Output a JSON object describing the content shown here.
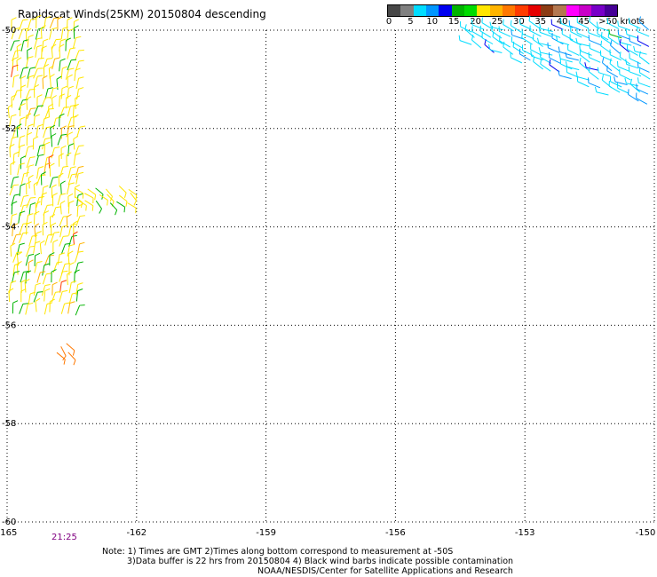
{
  "title": "Rapidscat Winds(25KM) 20150804 descending",
  "colorbar": {
    "segment_colors": [
      "#484848",
      "#808080",
      "#00dcff",
      "#0096ff",
      "#0000f0",
      "#00b400",
      "#00dc00",
      "#ffe600",
      "#ffb400",
      "#ff7800",
      "#ff3c00",
      "#e60000",
      "#8c3c14",
      "#b47850",
      "#ff00ff",
      "#c800c8",
      "#7800c8",
      "#460096"
    ],
    "labels": [
      {
        "text": "0",
        "value": 0
      },
      {
        "text": "5",
        "value": 5
      },
      {
        "text": "10",
        "value": 10
      },
      {
        "text": "15",
        "value": 15
      },
      {
        "text": "20",
        "value": 20
      },
      {
        "text": "25",
        "value": 25
      },
      {
        "text": "30",
        "value": 30
      },
      {
        "text": "35",
        "value": 35
      },
      {
        "text": "40",
        "value": 40
      },
      {
        "text": "45",
        "value": 45
      },
      {
        "text": ">50 knots",
        "value": 50
      }
    ]
  },
  "map": {
    "lon_range": [
      -165,
      -150
    ],
    "lat_range": [
      -60,
      -50
    ],
    "lon_ticks": [
      {
        "label": "-165",
        "value": -165
      },
      {
        "label": "-162",
        "value": -162
      },
      {
        "label": "-159",
        "value": -159
      },
      {
        "label": "-156",
        "value": -156
      },
      {
        "label": "-153",
        "value": -153
      },
      {
        "label": "-150",
        "value": -150
      }
    ],
    "lat_ticks": [
      {
        "label": "-50",
        "value": -50
      },
      {
        "label": "-52",
        "value": -52
      },
      {
        "label": "-54",
        "value": -54
      },
      {
        "label": "-56",
        "value": -56
      },
      {
        "label": "-58",
        "value": -58
      },
      {
        "label": "-60",
        "value": -60
      }
    ],
    "gridlines": "dotted"
  },
  "wind_swaths": [
    {
      "name": "left-swath",
      "lon_range": [
        -164.9,
        -163.4
      ],
      "lat_range": [
        -55.8,
        -50
      ],
      "dominant_speed_knots": 20,
      "colors": [
        "#ffe600",
        "#00b400",
        "#ffb400",
        "#ff3c00"
      ]
    },
    {
      "name": "left-tail",
      "lon_range": [
        -163.4,
        -162
      ],
      "lat_range": [
        -53.6,
        -53.2
      ],
      "dominant_speed_knots": 20,
      "colors": [
        "#ffe600",
        "#00b400"
      ]
    },
    {
      "name": "isolated-barb",
      "lon_range": [
        -163.8,
        -163.5
      ],
      "lat_range": [
        -56.6,
        -56.4
      ],
      "dominant_speed_knots": 30,
      "colors": [
        "#ff7800"
      ]
    },
    {
      "name": "right-swath",
      "lon_range": [
        -154.2,
        -150
      ],
      "lat_range": [
        -51.6,
        -50
      ],
      "dominant_speed_knots": 10,
      "colors": [
        "#00dcff",
        "#0096ff",
        "#0000f0",
        "#00b400"
      ]
    }
  ],
  "timestamp": "21:25",
  "notes": [
    "Note: 1) Times are GMT 2)Times along bottom correspond to measurement at -50S",
    "3)Data buffer is 22 hrs from 20150804 4) Black wind barbs indicate possible contamination",
    "NOAA/NESDIS/Center for Satellite Applications and Research"
  ]
}
